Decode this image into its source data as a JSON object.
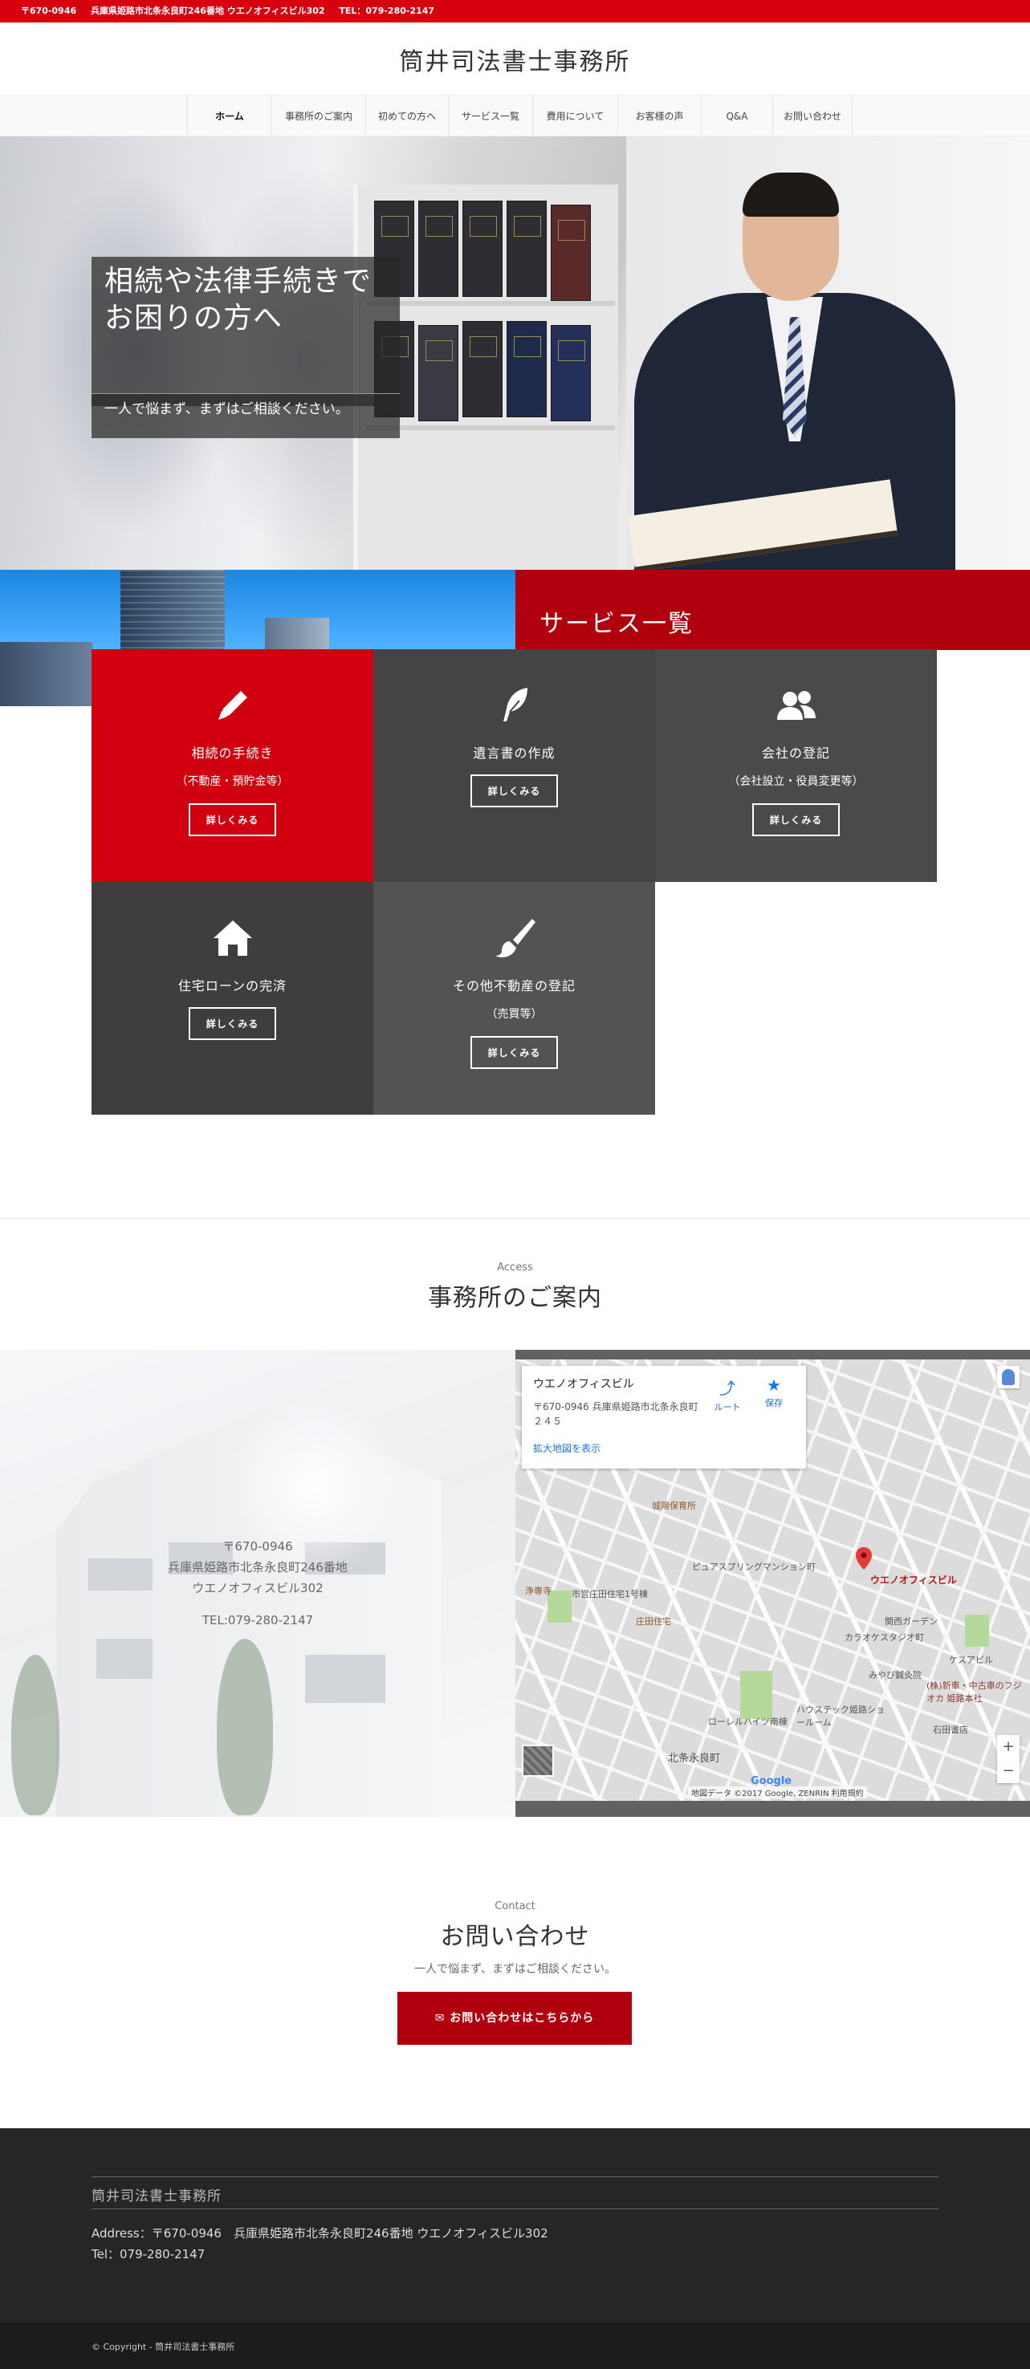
{
  "topbar": {
    "zip": "〒670-0946",
    "address": "兵庫県姫路市北条永良町246番地 ウエノオフィスビル302",
    "tel": "TEL：079-280-2147"
  },
  "header": {
    "logo": "筒井司法書士事務所"
  },
  "nav": {
    "items": [
      {
        "label": "ホーム"
      },
      {
        "label": "事務所のご案内"
      },
      {
        "label": "初めての方へ"
      },
      {
        "label": "サービス一覧"
      },
      {
        "label": "費用について"
      },
      {
        "label": "お客様の声"
      },
      {
        "label": "Q&A"
      },
      {
        "label": "お問い合わせ"
      }
    ]
  },
  "hero": {
    "title": "相続や法律手続きでお困りの方へ",
    "subtitle": "一人で悩まず、まずはご相談ください。"
  },
  "services": {
    "heading": "サービス一覧",
    "items": [
      {
        "title": "相続の手続き",
        "sub": "（不動産・預貯金等）",
        "button": "詳しくみる",
        "icon": "pencil-icon"
      },
      {
        "title": "遺言書の作成",
        "sub": "",
        "button": "詳しくみる",
        "icon": "quill-icon"
      },
      {
        "title": "会社の登記",
        "sub": "（会社設立・役員変更等）",
        "button": "詳しくみる",
        "icon": "users-icon"
      },
      {
        "title": "住宅ローンの完済",
        "sub": "",
        "button": "詳しくみる",
        "icon": "house-icon"
      },
      {
        "title": "その他不動産の登記",
        "sub": "（売買等）",
        "button": "詳しくみる",
        "icon": "paintbrush-icon"
      }
    ]
  },
  "access": {
    "small": "Access",
    "title": "事務所のご案内",
    "zip": "〒670-0946",
    "address": "兵庫県姫路市北条永良町246番地",
    "building": "ウエノオフィスビル302",
    "tel": "TEL:079-280-2147"
  },
  "map": {
    "card_name": "ウエノオフィスビル",
    "card_address": "〒670-0946 兵庫県姫路市北条永良町２４５",
    "card_link": "拡大地図を表示",
    "route": "ルート",
    "save": "保存",
    "pin_label": "ウエノオフィスビル",
    "labels": {
      "nursery": "城陽保育所",
      "jokyoji": "浄専寺",
      "shoda": "庄田住宅",
      "hojo": "北条永良町",
      "karaoke": "カラオケスタジオ町",
      "miyabi": "みやび鍼灸院",
      "kyasupel": "ケスアビル",
      "fujikawa": "(株)新車・中古車のフジオカ 姫路本社",
      "kansai": "関西ガーデン",
      "haustec": "ハウステック姫路ショールーム",
      "loreal": "ローレルハイツ南棟",
      "pure": "ピュアスプリングマンション町",
      "ishiyama": "石田書店",
      "grid_road": "市営庄田住宅1号棟"
    },
    "google": "Google",
    "copyright": "地図データ ©2017 Google, ZENRIN  利用規約",
    "zoom_in": "+",
    "zoom_out": "−"
  },
  "contact": {
    "small": "Contact",
    "title": "お問い合わせ",
    "subtitle": "一人で悩まず、まずはご相談ください。",
    "button": "お問い合わせはこちらから",
    "button_icon": "✉"
  },
  "footer": {
    "name": "筒井司法書士事務所",
    "address": "Address：〒670-0946　兵庫県姫路市北条永良町246番地 ウエノオフィスビル302",
    "tel": "Tel：079-280-2147",
    "copyright": "© Copyright - 筒井司法書士事務所"
  },
  "colors": {
    "brand_red": "#d7000f",
    "dark_red": "#b0000e",
    "tile_dark": "#444444"
  }
}
